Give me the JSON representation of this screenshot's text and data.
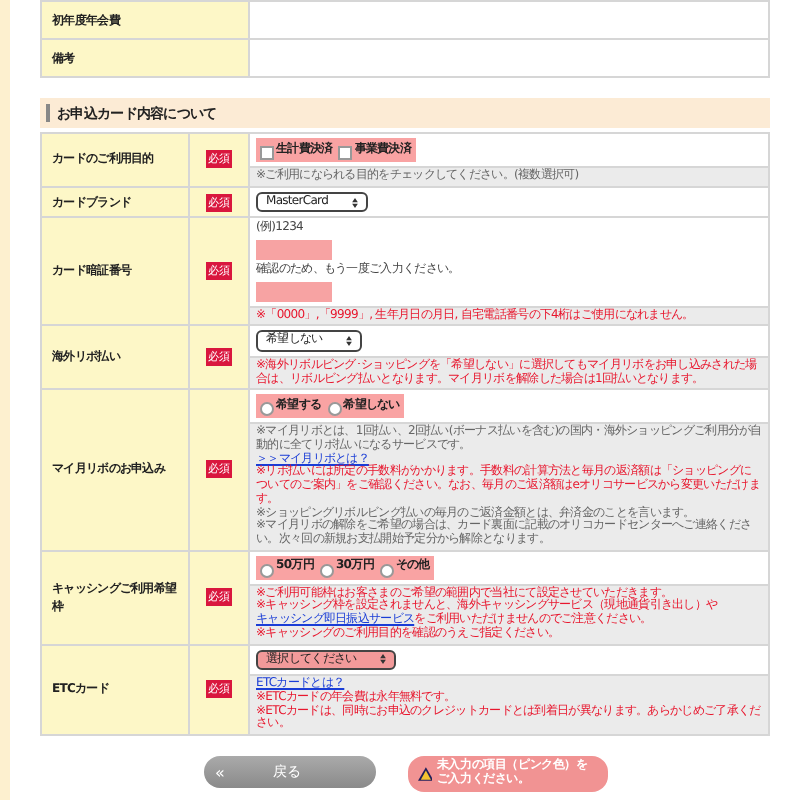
{
  "top_rows": [
    {
      "label": "初年度年会費"
    },
    {
      "label": "備考"
    }
  ],
  "section": {
    "title": "お申込カード内容について"
  },
  "rows": [
    {
      "label": "カードのご利用目的",
      "required": "必須",
      "fields": [
        {
          "kind": "checks",
          "missing": true,
          "options": [
            {
              "label": "生計費決済",
              "checked": false
            },
            {
              "label": "事業費決済",
              "checked": false
            }
          ]
        }
      ],
      "notes": [
        {
          "kind": "gray",
          "text": "※ご利用になられる目的をチェックしてください。(複数選択可)"
        }
      ]
    },
    {
      "label": "カードブランド",
      "required": "必須",
      "fields": [
        {
          "kind": "select",
          "missing": false,
          "value": "MasterCard"
        }
      ],
      "notes": []
    },
    {
      "label": "カード暗証番号",
      "required": "必須",
      "fields": [
        {
          "kind": "caption",
          "text": "(例)1234"
        },
        {
          "kind": "input",
          "missing": true
        },
        {
          "kind": "caption",
          "text": "確認のため、もう一度ご入力ください。"
        },
        {
          "kind": "input",
          "missing": true
        }
      ],
      "notes": [
        {
          "kind": "red",
          "text": "※「0000」,「9999」, 生年月日の月日, 自宅電話番号の下4桁はご使用になれません。"
        }
      ]
    },
    {
      "label": "海外リボ払い",
      "required": "必須",
      "fields": [
        {
          "kind": "select",
          "missing": false,
          "value": "希望しない"
        }
      ],
      "notes": [
        {
          "kind": "red",
          "text": "※海外リボルビング･ショッピングを「希望しない」に選択してもマイ月リボをお申し込みされた場合は、リボルビング払いとなります。マイ月リボを解除した場合は1回払いとなります。"
        }
      ]
    },
    {
      "label": "マイ月リボのお申込み",
      "required": "必須",
      "fields": [
        {
          "kind": "radios",
          "missing": true,
          "options": [
            {
              "label": "希望する",
              "selected": false
            },
            {
              "label": "希望しない",
              "selected": false
            }
          ]
        }
      ],
      "notes": [
        {
          "kind": "gray",
          "text": "※マイ月リボとは、1回払い、2回払い(ボーナス払いを含む)の国内・海外ショッピングご利用分が自動的に全てリボ払いになるサービスです。"
        },
        {
          "kind": "link",
          "text": "＞＞マイ月リボとは？"
        },
        {
          "kind": "red",
          "text": "※リボ払いには所定の手数料がかかります。手数料の計算方法と毎月の返済額は「ショッピングについてのご案内」をご確認ください。なお、毎月のご返済額はeオリコサービスから変更いただけます。"
        },
        {
          "kind": "gray",
          "text": "※ショッピングリボルビング払いの毎月のご返済金額とは、弁済金のことを言います。"
        },
        {
          "kind": "gray",
          "text": "※マイ月リボの解除をご希望の場合は、カード裏面に記載のオリコカードセンターへご連絡ください。次々回の新規お支払開始予定分から解除となります。"
        }
      ]
    },
    {
      "label": "キャッシングご利用希望枠",
      "required": "必須",
      "fields": [
        {
          "kind": "radios",
          "missing": true,
          "options": [
            {
              "label": "50万円",
              "selected": false
            },
            {
              "label": "30万円",
              "selected": false
            },
            {
              "label": "その他",
              "selected": false
            }
          ]
        }
      ],
      "notes": [
        {
          "kind": "red",
          "text": "※ご利用可能枠はお客さまのご希望の範囲内で当社にて設定させていただきます。"
        },
        {
          "kind": "red",
          "text": "※キャッシング枠を設定されませんと、海外キャッシングサービス（現地通貨引き出し）や",
          "link": "キャッシング即日振込サービス",
          "after": "をご利用いただけませんのでご注意ください。"
        },
        {
          "kind": "red",
          "text": "※キャッシングのご利用目的を確認のうえご指定ください。"
        }
      ]
    },
    {
      "label": "ETCカード",
      "required": "必須",
      "fields": [
        {
          "kind": "select",
          "missing": true,
          "value": "選択してください"
        }
      ],
      "notes": [
        {
          "kind": "link",
          "text": "ETCカードとは？"
        },
        {
          "kind": "red",
          "text": "※ETCカードの年会費は永年無料です。"
        },
        {
          "kind": "red",
          "text": "※ETCカードは、同時にお申込のクレジットカードとは到着日が異なります。あらかじめご了承ください。"
        }
      ]
    }
  ],
  "buttons": {
    "back": {
      "icon": "«",
      "label": "戻る"
    },
    "warning": {
      "label": "未入力の項目（ピンク色）をご入力ください。"
    }
  }
}
